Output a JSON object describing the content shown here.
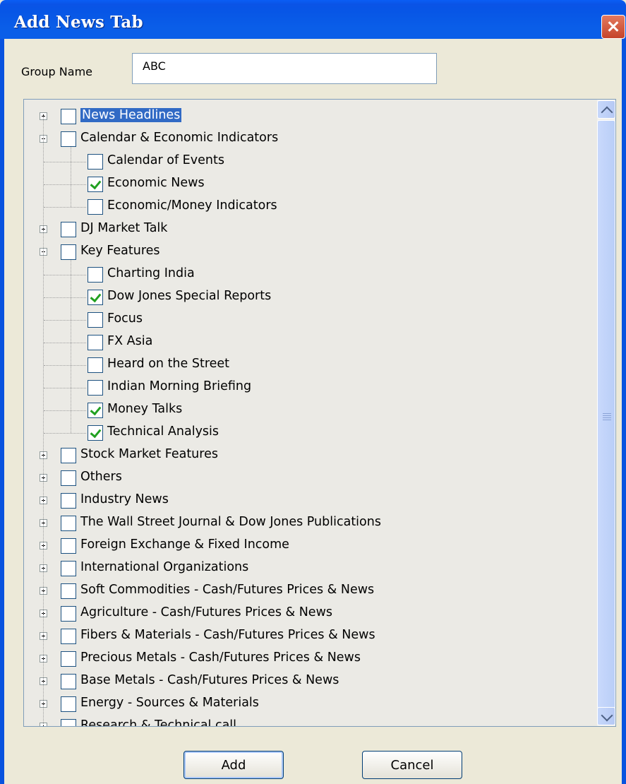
{
  "window": {
    "title": "Add News Tab"
  },
  "form": {
    "group_name_label": "Group Name",
    "group_name_value": "ABC"
  },
  "tree": {
    "items": [
      {
        "label": "News Headlines",
        "level": 0,
        "expander": "plus",
        "checked": false,
        "selected": true
      },
      {
        "label": "Calendar & Economic Indicators",
        "level": 0,
        "expander": "minus",
        "checked": false
      },
      {
        "label": "Calendar of Events",
        "level": 1,
        "checked": false
      },
      {
        "label": "Economic News",
        "level": 1,
        "checked": true
      },
      {
        "label": "Economic/Money Indicators",
        "level": 1,
        "checked": false
      },
      {
        "label": "DJ Market Talk",
        "level": 0,
        "expander": "plus",
        "checked": false
      },
      {
        "label": "Key Features",
        "level": 0,
        "expander": "minus",
        "checked": false
      },
      {
        "label": "Charting India",
        "level": 1,
        "checked": false
      },
      {
        "label": "Dow Jones Special Reports",
        "level": 1,
        "checked": true
      },
      {
        "label": "Focus",
        "level": 1,
        "checked": false
      },
      {
        "label": "FX Asia",
        "level": 1,
        "checked": false
      },
      {
        "label": "Heard on the Street",
        "level": 1,
        "checked": false
      },
      {
        "label": "Indian Morning Briefing",
        "level": 1,
        "checked": false
      },
      {
        "label": "Money Talks",
        "level": 1,
        "checked": true
      },
      {
        "label": "Technical Analysis",
        "level": 1,
        "checked": true
      },
      {
        "label": "Stock Market Features",
        "level": 0,
        "expander": "plus",
        "checked": false
      },
      {
        "label": "Others",
        "level": 0,
        "expander": "plus",
        "checked": false
      },
      {
        "label": "Industry News",
        "level": 0,
        "expander": "plus",
        "checked": false
      },
      {
        "label": "The Wall Street Journal & Dow Jones Publications",
        "level": 0,
        "expander": "plus",
        "checked": false
      },
      {
        "label": "Foreign Exchange & Fixed Income",
        "level": 0,
        "expander": "plus",
        "checked": false
      },
      {
        "label": "International Organizations",
        "level": 0,
        "expander": "plus",
        "checked": false
      },
      {
        "label": "Soft Commodities - Cash/Futures Prices & News",
        "level": 0,
        "expander": "plus",
        "checked": false
      },
      {
        "label": "Agriculture - Cash/Futures Prices & News",
        "level": 0,
        "expander": "plus",
        "checked": false
      },
      {
        "label": "Fibers & Materials - Cash/Futures Prices & News",
        "level": 0,
        "expander": "plus",
        "checked": false
      },
      {
        "label": "Precious Metals - Cash/Futures Prices & News",
        "level": 0,
        "expander": "plus",
        "checked": false
      },
      {
        "label": "Base Metals - Cash/Futures Prices & News",
        "level": 0,
        "expander": "plus",
        "checked": false
      },
      {
        "label": "Energy - Sources & Materials",
        "level": 0,
        "expander": "plus",
        "checked": false
      },
      {
        "label": "Research & Technical call",
        "level": 0,
        "expander": "plus",
        "checked": false
      }
    ]
  },
  "buttons": {
    "add_label": "Add",
    "cancel_label": "Cancel"
  },
  "icons": {
    "close": "close-icon",
    "expand": "plus-icon",
    "collapse": "minus-icon",
    "scroll_up": "chevron-up-icon",
    "scroll_down": "chevron-down-icon"
  },
  "colors": {
    "title_bar": "#0a5ee8",
    "selection": "#316ac5",
    "check": "#21a121"
  }
}
